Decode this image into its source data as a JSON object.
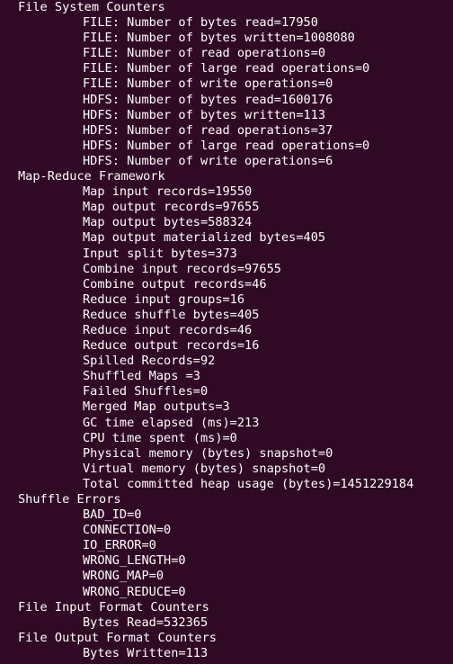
{
  "sections": [
    {
      "header": "File System Counters",
      "items": [
        "FILE: Number of bytes read=17950",
        "FILE: Number of bytes written=1008080",
        "FILE: Number of read operations=0",
        "FILE: Number of large read operations=0",
        "FILE: Number of write operations=0",
        "HDFS: Number of bytes read=1600176",
        "HDFS: Number of bytes written=113",
        "HDFS: Number of read operations=37",
        "HDFS: Number of large read operations=0",
        "HDFS: Number of write operations=6"
      ]
    },
    {
      "header": "Map-Reduce Framework",
      "items": [
        "Map input records=19550",
        "Map output records=97655",
        "Map output bytes=588324",
        "Map output materialized bytes=405",
        "Input split bytes=373",
        "Combine input records=97655",
        "Combine output records=46",
        "Reduce input groups=16",
        "Reduce shuffle bytes=405",
        "Reduce input records=46",
        "Reduce output records=16",
        "Spilled Records=92",
        "Shuffled Maps =3",
        "Failed Shuffles=0",
        "Merged Map outputs=3",
        "GC time elapsed (ms)=213",
        "CPU time spent (ms)=0",
        "Physical memory (bytes) snapshot=0",
        "Virtual memory (bytes) snapshot=0",
        "Total committed heap usage (bytes)=1451229184"
      ]
    },
    {
      "header": "Shuffle Errors",
      "items": [
        "BAD_ID=0",
        "CONNECTION=0",
        "IO_ERROR=0",
        "WRONG_LENGTH=0",
        "WRONG_MAP=0",
        "WRONG_REDUCE=0"
      ]
    },
    {
      "header": "File Input Format Counters",
      "items": [
        "Bytes Read=532365"
      ]
    },
    {
      "header": "File Output Format Counters",
      "items": [
        "Bytes Written=113"
      ]
    }
  ],
  "colors": {
    "background": "#300a24",
    "text": "#ffffff"
  }
}
